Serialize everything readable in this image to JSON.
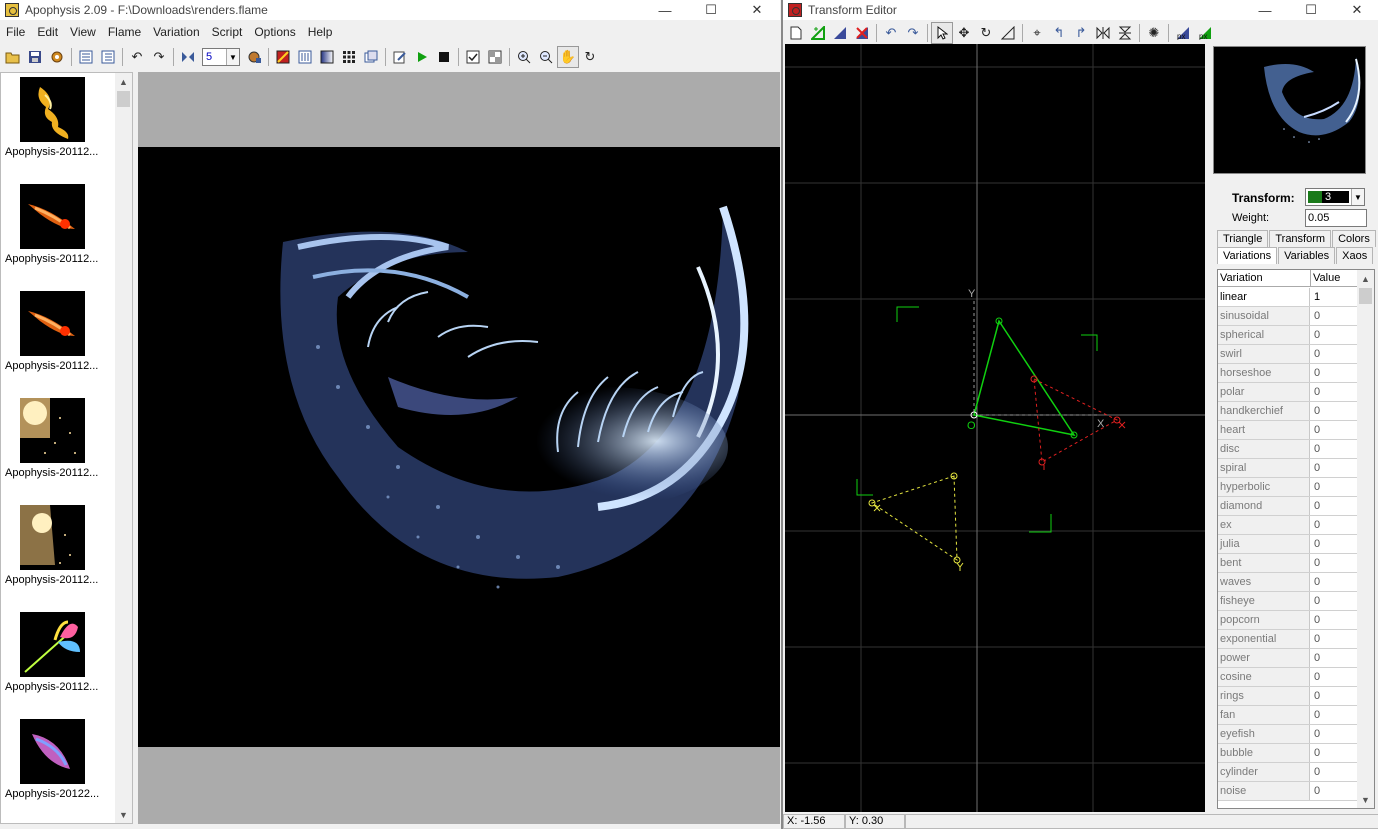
{
  "main_window": {
    "title": "Apophysis 2.09 - F:\\Downloads\\renders.flame",
    "menu": [
      "File",
      "Edit",
      "View",
      "Flame",
      "Variation",
      "Script",
      "Options",
      "Help"
    ],
    "toolbar": {
      "group1": [
        "open-icon",
        "save-icon",
        "gear-icon"
      ],
      "group2": [
        "list-icon",
        "details-icon"
      ],
      "group3": [
        "undo-icon",
        "redo-icon"
      ],
      "group4": [
        "mutate-icon"
      ],
      "density_value": "5",
      "group5": [
        "render-icon"
      ],
      "group6": [
        "editor-icon",
        "adjust-icon",
        "gradient-icon",
        "grid-icon",
        "options-icon"
      ],
      "group7": [
        "script-edit-icon",
        "play-icon",
        "stop-icon"
      ],
      "group8": [
        "check-icon",
        "transparency-icon"
      ],
      "group9": [
        "zoom-in-icon",
        "zoom-out-icon",
        "hand-icon",
        "rotate-icon"
      ]
    },
    "flames": [
      {
        "name": "Apophysis-20112..."
      },
      {
        "name": "Apophysis-20112..."
      },
      {
        "name": "Apophysis-20112..."
      },
      {
        "name": "Apophysis-20112..."
      },
      {
        "name": "Apophysis-20112..."
      },
      {
        "name": "Apophysis-20112..."
      },
      {
        "name": "Apophysis-20122..."
      }
    ]
  },
  "transform_editor": {
    "title": "Transform Editor",
    "toolbar": [
      "new-icon",
      "add-triangle-icon",
      "duplicate-icon",
      "delete-icon",
      "undo-icon",
      "redo-icon",
      "select-icon",
      "move-icon",
      "rotate-icon",
      "scale-icon",
      "center-icon",
      "rotate-left-icon",
      "rotate-right-icon",
      "flip-h-icon",
      "flip-v-icon",
      "show-var-icon",
      "post-x-icon",
      "post-y-icon"
    ],
    "grid_labels": {
      "y": "Y",
      "o": "O",
      "x": "X"
    },
    "transform_label": "Transform:",
    "transform_value": "3",
    "weight_label": "Weight:",
    "weight_value": "0.05",
    "tabs_row1": [
      "Triangle",
      "Transform",
      "Colors"
    ],
    "tabs_row2": [
      "Variations",
      "Variables",
      "Xaos"
    ],
    "table_headers": [
      "Variation",
      "Value"
    ],
    "variations": [
      {
        "name": "linear",
        "value": "1"
      },
      {
        "name": "sinusoidal",
        "value": "0"
      },
      {
        "name": "spherical",
        "value": "0"
      },
      {
        "name": "swirl",
        "value": "0"
      },
      {
        "name": "horseshoe",
        "value": "0"
      },
      {
        "name": "polar",
        "value": "0"
      },
      {
        "name": "handkerchief",
        "value": "0"
      },
      {
        "name": "heart",
        "value": "0"
      },
      {
        "name": "disc",
        "value": "0"
      },
      {
        "name": "spiral",
        "value": "0"
      },
      {
        "name": "hyperbolic",
        "value": "0"
      },
      {
        "name": "diamond",
        "value": "0"
      },
      {
        "name": "ex",
        "value": "0"
      },
      {
        "name": "julia",
        "value": "0"
      },
      {
        "name": "bent",
        "value": "0"
      },
      {
        "name": "waves",
        "value": "0"
      },
      {
        "name": "fisheye",
        "value": "0"
      },
      {
        "name": "popcorn",
        "value": "0"
      },
      {
        "name": "exponential",
        "value": "0"
      },
      {
        "name": "power",
        "value": "0"
      },
      {
        "name": "cosine",
        "value": "0"
      },
      {
        "name": "rings",
        "value": "0"
      },
      {
        "name": "fan",
        "value": "0"
      },
      {
        "name": "eyefish",
        "value": "0"
      },
      {
        "name": "bubble",
        "value": "0"
      },
      {
        "name": "cylinder",
        "value": "0"
      },
      {
        "name": "noise",
        "value": "0"
      }
    ],
    "status_x": "X: -1.56",
    "status_y": "Y: 0.30"
  },
  "window_controls": {
    "minimize": "—",
    "maximize": "☐",
    "close": "✕"
  },
  "colors": {
    "accent_green": "#00c000",
    "triangle_red": "#e02020",
    "triangle_yellow": "#e6e640"
  }
}
